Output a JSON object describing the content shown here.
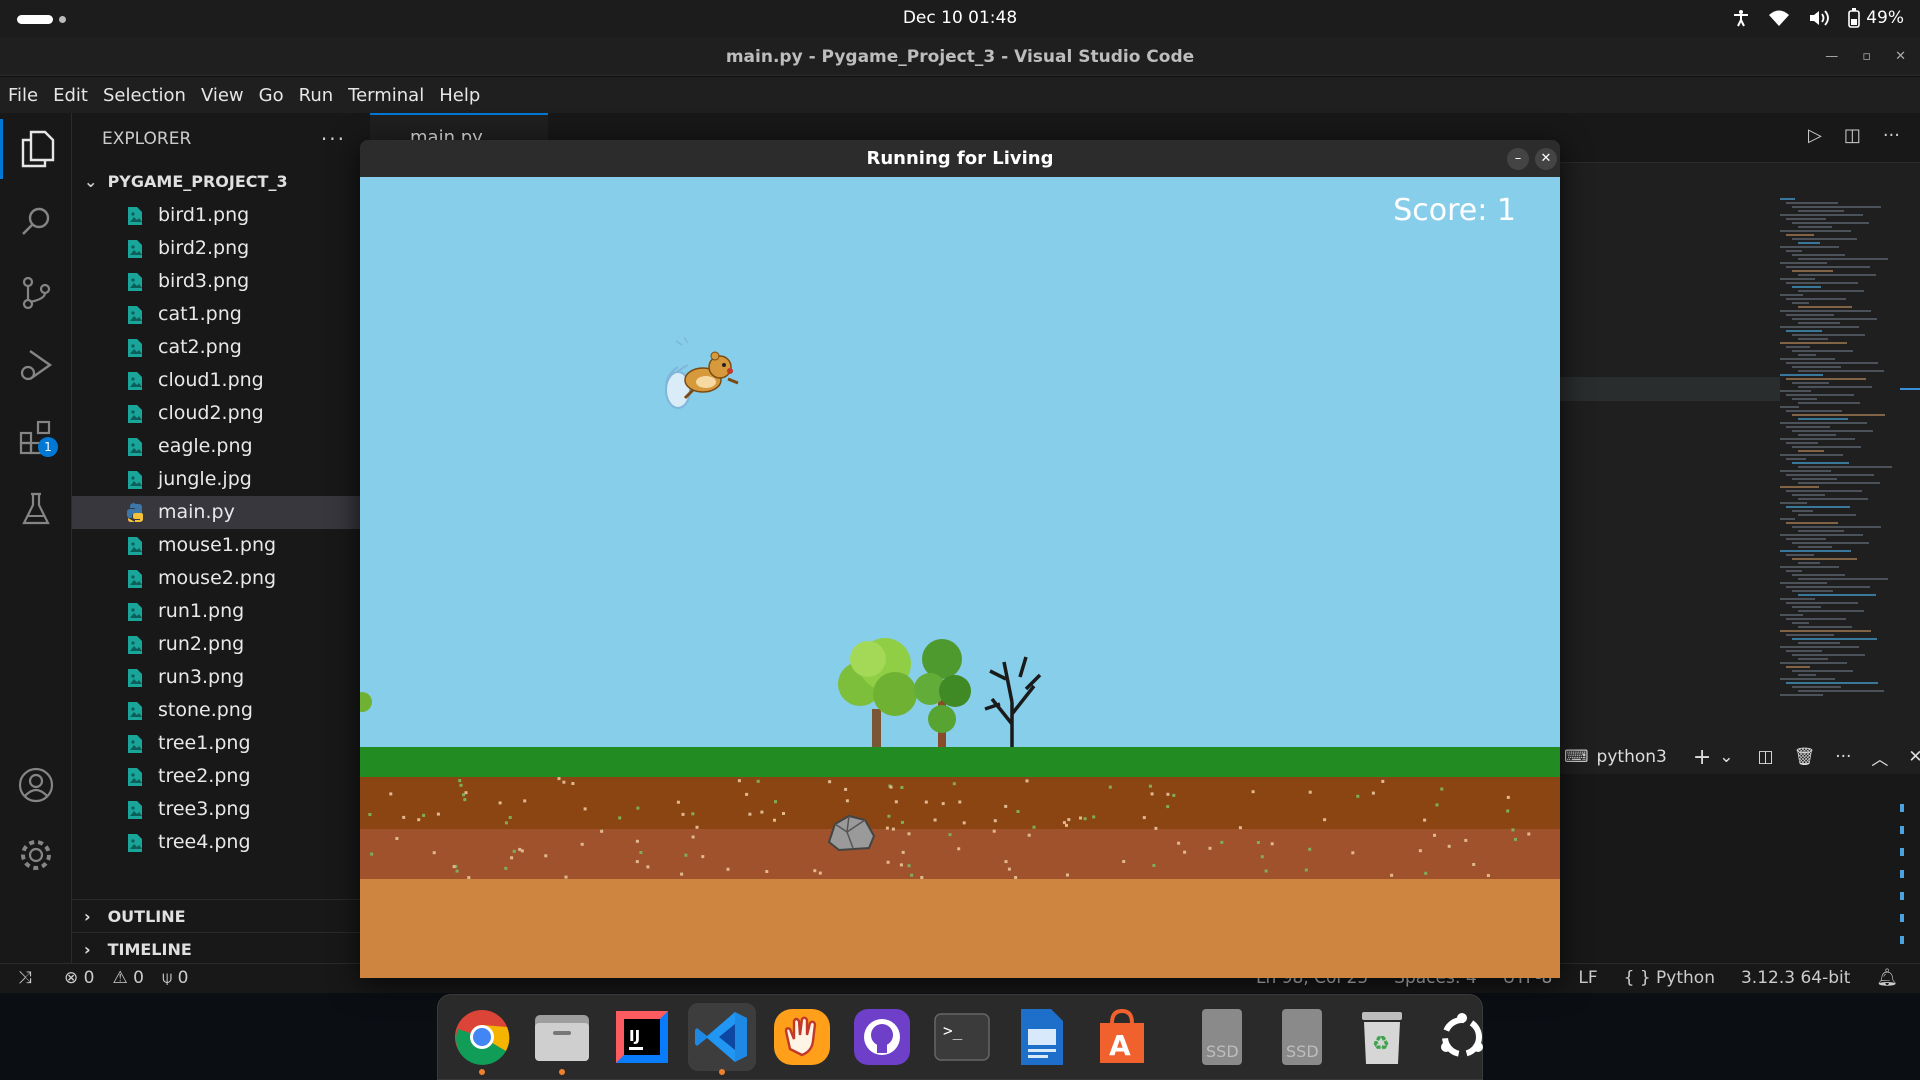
{
  "system": {
    "clock": "Dec 10  01:48",
    "battery": "49%"
  },
  "vscode": {
    "window_title": "main.py - Pygame_Project_3 - Visual Studio Code",
    "menu": [
      "File",
      "Edit",
      "Selection",
      "View",
      "Go",
      "Run",
      "Terminal",
      "Help"
    ],
    "activity_badge": "1",
    "explorer": {
      "header": "EXPLORER",
      "project": "PYGAME_PROJECT_3",
      "files": [
        "bird1.png",
        "bird2.png",
        "bird3.png",
        "cat1.png",
        "cat2.png",
        "cloud1.png",
        "cloud2.png",
        "eagle.png",
        "jungle.jpg",
        "main.py",
        "mouse1.png",
        "mouse2.png",
        "run1.png",
        "run2.png",
        "run3.png",
        "stone.png",
        "tree1.png",
        "tree2.png",
        "tree3.png",
        "tree4.png"
      ],
      "selected": "main.py",
      "outline": "OUTLINE",
      "timeline": "TIMELINE"
    },
    "tab_label": "main.py",
    "terminal_label": "python3",
    "status": {
      "errors": "0",
      "warnings": "0",
      "ports": "0",
      "position": "Ln 98, Col 25",
      "spaces": "Spaces: 4",
      "encoding": "UTF-8",
      "eol": "LF",
      "language": "Python",
      "interpreter": "3.12.3 64-bit"
    }
  },
  "game": {
    "title": "Running for Living",
    "score": "Score: 1",
    "colors": {
      "sky": "#87ceeb",
      "grass": "#228b22",
      "soil_top": "#8b4513",
      "soil_mid": "#a0522d",
      "sand": "#cd853f"
    }
  },
  "dock": {
    "apps": [
      "chrome-icon",
      "files-icon",
      "intellij-icon",
      "vscode-icon",
      "handy-icon",
      "github-desktop-icon",
      "terminal-icon",
      "text-editor-icon",
      "app-center-icon",
      "ssd-drive-icon",
      "ssd-drive-icon",
      "trash-icon",
      "show-apps-icon"
    ],
    "ssd_label": "SSD"
  }
}
